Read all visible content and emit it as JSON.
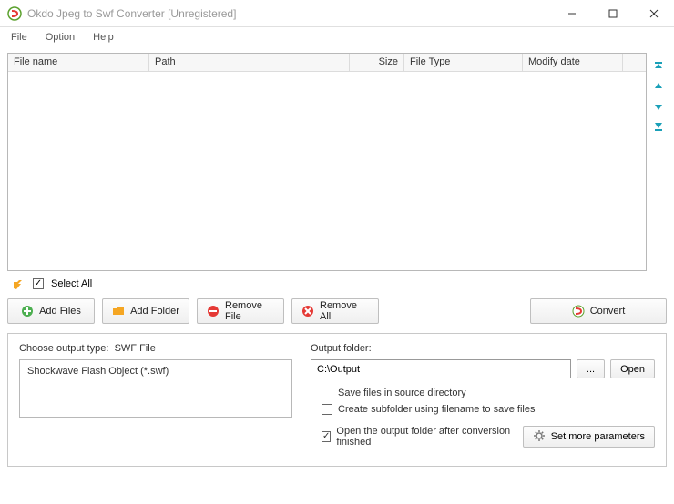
{
  "window": {
    "title": "Okdo Jpeg to Swf Converter [Unregistered]"
  },
  "menu": {
    "file": "File",
    "option": "Option",
    "help": "Help"
  },
  "columns": {
    "name": "File name",
    "path": "Path",
    "size": "Size",
    "type": "File Type",
    "modify": "Modify date"
  },
  "selectall": {
    "label": "Select All",
    "checked": true
  },
  "buttons": {
    "add_files": "Add Files",
    "add_folder": "Add Folder",
    "remove_file": "Remove File",
    "remove_all": "Remove All",
    "convert": "Convert"
  },
  "output_type": {
    "label_prefix": "Choose output type:",
    "label_value": "SWF File",
    "option": "Shockwave Flash Object (*.swf)"
  },
  "output_folder": {
    "label": "Output folder:",
    "value": "C:\\Output",
    "browse": "...",
    "open": "Open"
  },
  "checks": {
    "save_source": {
      "label": "Save files in source directory",
      "checked": false
    },
    "create_subfolder": {
      "label": "Create subfolder using filename to save files",
      "checked": false
    },
    "open_after": {
      "label": "Open the output folder after conversion finished",
      "checked": true
    }
  },
  "more_params": "Set more parameters"
}
